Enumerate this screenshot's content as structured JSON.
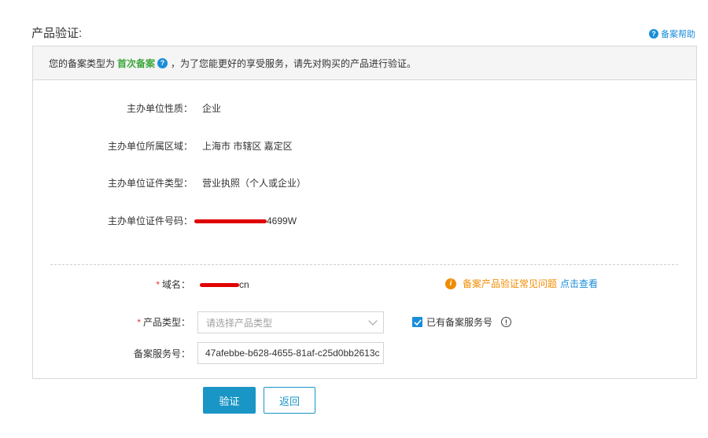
{
  "header": {
    "title": "产品验证:",
    "help_icon": "question-circle-icon",
    "help_label": "备案帮助"
  },
  "notice": {
    "prefix": "您的备案类型为",
    "type": "首次备案",
    "suffix": "，为了您能更好的享受服务，请先对购买的产品进行验证。"
  },
  "info": {
    "nature_label": "主办单位性质：",
    "nature_value": "企业",
    "region_label": "主办单位所属区域：",
    "region_value": "上海市 市辖区 嘉定区",
    "cert_type_label": "主办单位证件类型：",
    "cert_type_value": "营业执照（个人或企业）",
    "cert_no_label": "主办单位证件号码：",
    "cert_no_visible": "4699W"
  },
  "form": {
    "domain_label": "域名：",
    "domain_visible": "cn",
    "product_type_label": "产品类型：",
    "product_type_placeholder": "请选择产品类型",
    "service_no_label": "备案服务号：",
    "service_no_value": "47afebbe-b628-4655-81af-c25d0bb2613c",
    "has_service_label": "已有备案服务号",
    "has_service_checked": true,
    "required_mark": "*"
  },
  "faq": {
    "text": "备案产品验证常见问题",
    "link": "点击查看"
  },
  "buttons": {
    "verify": "验证",
    "back": "返回"
  },
  "colors": {
    "accent": "#1a96c6",
    "link": "#1a8dd9",
    "warning": "#f08c00",
    "success": "#3ba63b",
    "required": "#e4393c"
  }
}
